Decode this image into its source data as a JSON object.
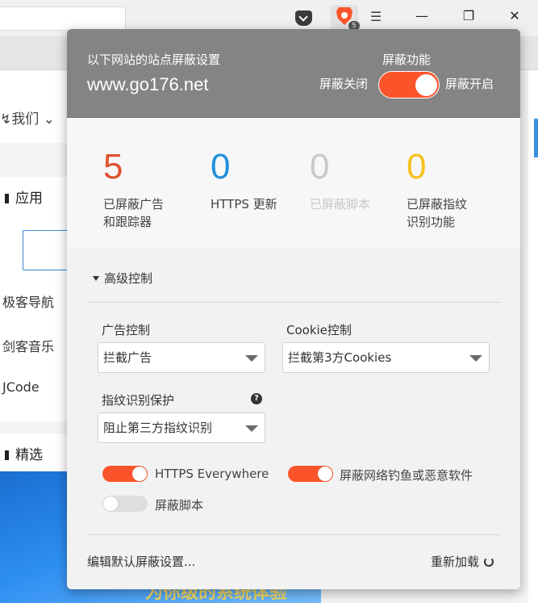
{
  "toolbar": {
    "shield_badge_count": "5",
    "menu_glyph": "☰",
    "window_controls": [
      "—",
      "❐",
      "✕"
    ]
  },
  "page": {
    "nav_partial": "↯我们 ⌄",
    "section_apps": "应用",
    "section_featured": "精选",
    "app_links": [
      "极客导航",
      "剑客音乐",
      "JCode"
    ],
    "hero_partial_text": "为你级的系统体验"
  },
  "shields": {
    "header_label": "以下网站的站点屏蔽设置",
    "site": "www.go176.net",
    "function_label": "屏蔽功能",
    "off_label": "屏蔽关闭",
    "on_label": "屏蔽开启",
    "enabled": true,
    "stats": [
      {
        "value": "5",
        "label": "已屏蔽广告\n和跟踪器",
        "color": "#e0522e",
        "muted": false
      },
      {
        "value": "0",
        "label": "HTTPS 更新",
        "color": "#1f90d8",
        "muted": false
      },
      {
        "value": "0",
        "label": "已屏蔽脚本",
        "color": "#c8c8c8",
        "muted": true
      },
      {
        "value": "0",
        "label": "已屏蔽指纹\n识别功能",
        "color": "#f6c21a",
        "muted": false
      }
    ],
    "advanced_title": "高级控制",
    "ad_control_label": "广告控制",
    "ad_control_value": "拦截广告",
    "cookie_control_label": "Cookie控制",
    "cookie_control_value": "拦截第3方Cookies",
    "fingerprint_label": "指纹识别保护",
    "fingerprint_value": "阻止第三方指纹识别",
    "help_glyph": "?",
    "toggles": [
      {
        "label": "HTTPS Everywhere",
        "on": true
      },
      {
        "label": "屏蔽网络钓鱼或恶意软件",
        "on": true
      },
      {
        "label": "屏蔽脚本",
        "on": false
      }
    ],
    "footer_edit_defaults": "编辑默认屏蔽设置...",
    "footer_reload": "重新加载"
  },
  "colors": {
    "brave_orange": "#fb542b",
    "header_gray": "#848484"
  }
}
